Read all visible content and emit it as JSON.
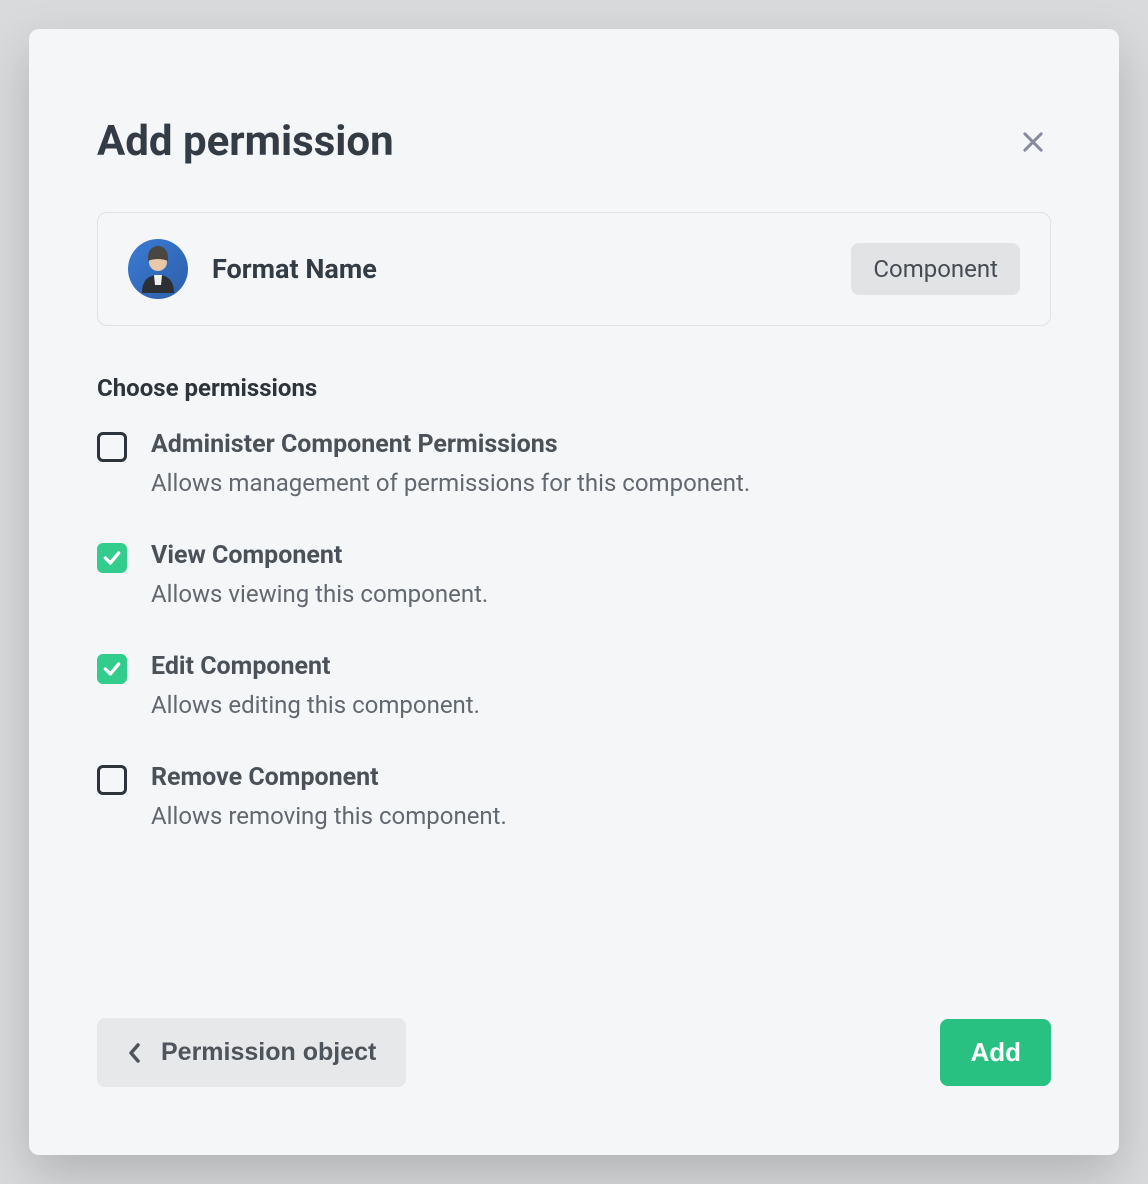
{
  "modal": {
    "title": "Add permission",
    "entity": {
      "name": "Format Name",
      "tag": "Component"
    },
    "section_label": "Choose permissions",
    "permissions": [
      {
        "title": "Administer Component Permissions",
        "description": "Allows management of permissions for this component.",
        "checked": false
      },
      {
        "title": "View Component",
        "description": "Allows viewing this component.",
        "checked": true
      },
      {
        "title": "Edit Component",
        "description": "Allows editing this component.",
        "checked": true
      },
      {
        "title": "Remove Component",
        "description": "Allows removing this component.",
        "checked": false
      }
    ],
    "footer": {
      "back_label": "Permission object",
      "add_label": "Add"
    }
  }
}
